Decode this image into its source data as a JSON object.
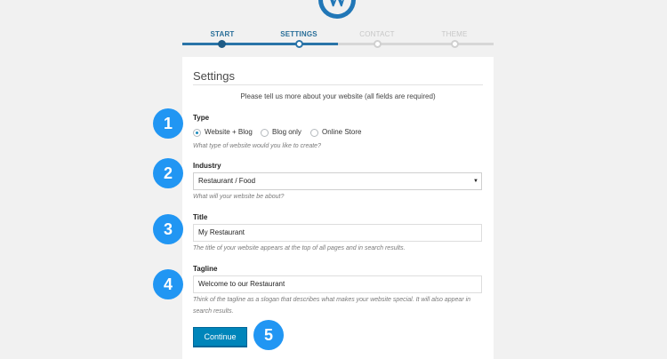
{
  "steps": [
    {
      "label": "START",
      "state": "done"
    },
    {
      "label": "SETTINGS",
      "state": "current"
    },
    {
      "label": "CONTACT",
      "state": "todo"
    },
    {
      "label": "THEME",
      "state": "todo"
    }
  ],
  "panel": {
    "title": "Settings",
    "intro": "Please tell us more about your website (all fields are required)"
  },
  "type": {
    "label": "Type",
    "options": [
      "Website + Blog",
      "Blog only",
      "Online Store"
    ],
    "selected": "Website + Blog",
    "help": "What type of website would you like to create?"
  },
  "industry": {
    "label": "Industry",
    "value": "Restaurant / Food",
    "arrow": "▼",
    "help": "What will your website be about?"
  },
  "title_field": {
    "label": "Title",
    "value": "My Restaurant",
    "help": "The title of your website appears at the top of all pages and in search results."
  },
  "tagline": {
    "label": "Tagline",
    "value": "Welcome to our Restaurant",
    "help_line1": "Think of the tagline as a slogan that describes what makes your website special. It will also appear in",
    "help_line2": "search results."
  },
  "continue_label": "Continue",
  "badges": [
    "1",
    "2",
    "3",
    "4",
    "5"
  ],
  "logo_letter": "W",
  "colors": {
    "accent": "#0085ba",
    "badge": "#2196f3",
    "progress": "#2a74a8"
  }
}
